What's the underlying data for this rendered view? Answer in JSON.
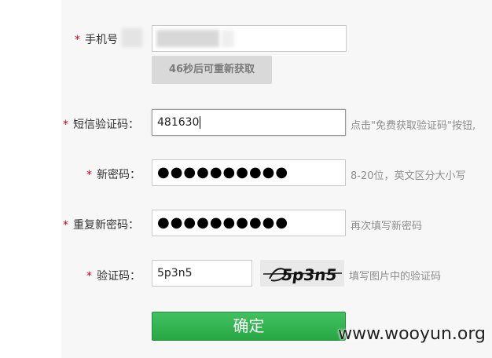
{
  "form": {
    "phone": {
      "star": "*",
      "label": "手机号",
      "value": ""
    },
    "resend_button": "46秒后可重新获取",
    "sms_code": {
      "star": "*",
      "label": "短信验证码：",
      "value": "481630",
      "hint": "点击\"免费获取验证码\"按钮,"
    },
    "new_password": {
      "star": "*",
      "label": "新密码：",
      "value": "●●●●●●●●●●",
      "hint": "8-20位，英文区分大小写"
    },
    "repeat_password": {
      "star": "*",
      "label": "重复新密码：",
      "value": "●●●●●●●●●●",
      "hint": "再次填写新密码"
    },
    "captcha": {
      "star": "*",
      "label": "验证码：",
      "value": "5p3n5",
      "image_text": "5p3n5",
      "hint": "填写图片中的验证码"
    },
    "confirm_button": "确定"
  },
  "watermark": "www.wooyun.org",
  "colors": {
    "required_star": "#d0021b",
    "confirm_button": "#2fb04c",
    "hint_text": "#8d8d8d",
    "panel_background": "#f7f7f7"
  }
}
